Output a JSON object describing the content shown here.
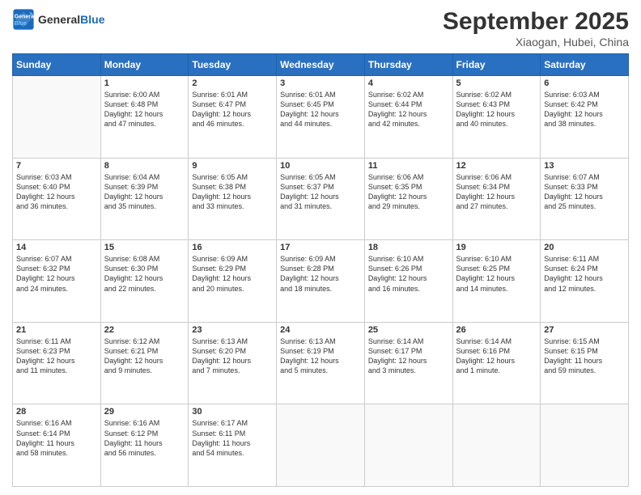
{
  "logo": {
    "line1": "General",
    "line2": "Blue"
  },
  "title": "September 2025",
  "subtitle": "Xiaogan, Hubei, China",
  "days_header": [
    "Sunday",
    "Monday",
    "Tuesday",
    "Wednesday",
    "Thursday",
    "Friday",
    "Saturday"
  ],
  "weeks": [
    [
      {
        "num": "",
        "info": ""
      },
      {
        "num": "1",
        "info": "Sunrise: 6:00 AM\nSunset: 6:48 PM\nDaylight: 12 hours\nand 47 minutes."
      },
      {
        "num": "2",
        "info": "Sunrise: 6:01 AM\nSunset: 6:47 PM\nDaylight: 12 hours\nand 46 minutes."
      },
      {
        "num": "3",
        "info": "Sunrise: 6:01 AM\nSunset: 6:45 PM\nDaylight: 12 hours\nand 44 minutes."
      },
      {
        "num": "4",
        "info": "Sunrise: 6:02 AM\nSunset: 6:44 PM\nDaylight: 12 hours\nand 42 minutes."
      },
      {
        "num": "5",
        "info": "Sunrise: 6:02 AM\nSunset: 6:43 PM\nDaylight: 12 hours\nand 40 minutes."
      },
      {
        "num": "6",
        "info": "Sunrise: 6:03 AM\nSunset: 6:42 PM\nDaylight: 12 hours\nand 38 minutes."
      }
    ],
    [
      {
        "num": "7",
        "info": "Sunrise: 6:03 AM\nSunset: 6:40 PM\nDaylight: 12 hours\nand 36 minutes."
      },
      {
        "num": "8",
        "info": "Sunrise: 6:04 AM\nSunset: 6:39 PM\nDaylight: 12 hours\nand 35 minutes."
      },
      {
        "num": "9",
        "info": "Sunrise: 6:05 AM\nSunset: 6:38 PM\nDaylight: 12 hours\nand 33 minutes."
      },
      {
        "num": "10",
        "info": "Sunrise: 6:05 AM\nSunset: 6:37 PM\nDaylight: 12 hours\nand 31 minutes."
      },
      {
        "num": "11",
        "info": "Sunrise: 6:06 AM\nSunset: 6:35 PM\nDaylight: 12 hours\nand 29 minutes."
      },
      {
        "num": "12",
        "info": "Sunrise: 6:06 AM\nSunset: 6:34 PM\nDaylight: 12 hours\nand 27 minutes."
      },
      {
        "num": "13",
        "info": "Sunrise: 6:07 AM\nSunset: 6:33 PM\nDaylight: 12 hours\nand 25 minutes."
      }
    ],
    [
      {
        "num": "14",
        "info": "Sunrise: 6:07 AM\nSunset: 6:32 PM\nDaylight: 12 hours\nand 24 minutes."
      },
      {
        "num": "15",
        "info": "Sunrise: 6:08 AM\nSunset: 6:30 PM\nDaylight: 12 hours\nand 22 minutes."
      },
      {
        "num": "16",
        "info": "Sunrise: 6:09 AM\nSunset: 6:29 PM\nDaylight: 12 hours\nand 20 minutes."
      },
      {
        "num": "17",
        "info": "Sunrise: 6:09 AM\nSunset: 6:28 PM\nDaylight: 12 hours\nand 18 minutes."
      },
      {
        "num": "18",
        "info": "Sunrise: 6:10 AM\nSunset: 6:26 PM\nDaylight: 12 hours\nand 16 minutes."
      },
      {
        "num": "19",
        "info": "Sunrise: 6:10 AM\nSunset: 6:25 PM\nDaylight: 12 hours\nand 14 minutes."
      },
      {
        "num": "20",
        "info": "Sunrise: 6:11 AM\nSunset: 6:24 PM\nDaylight: 12 hours\nand 12 minutes."
      }
    ],
    [
      {
        "num": "21",
        "info": "Sunrise: 6:11 AM\nSunset: 6:23 PM\nDaylight: 12 hours\nand 11 minutes."
      },
      {
        "num": "22",
        "info": "Sunrise: 6:12 AM\nSunset: 6:21 PM\nDaylight: 12 hours\nand 9 minutes."
      },
      {
        "num": "23",
        "info": "Sunrise: 6:13 AM\nSunset: 6:20 PM\nDaylight: 12 hours\nand 7 minutes."
      },
      {
        "num": "24",
        "info": "Sunrise: 6:13 AM\nSunset: 6:19 PM\nDaylight: 12 hours\nand 5 minutes."
      },
      {
        "num": "25",
        "info": "Sunrise: 6:14 AM\nSunset: 6:17 PM\nDaylight: 12 hours\nand 3 minutes."
      },
      {
        "num": "26",
        "info": "Sunrise: 6:14 AM\nSunset: 6:16 PM\nDaylight: 12 hours\nand 1 minute."
      },
      {
        "num": "27",
        "info": "Sunrise: 6:15 AM\nSunset: 6:15 PM\nDaylight: 11 hours\nand 59 minutes."
      }
    ],
    [
      {
        "num": "28",
        "info": "Sunrise: 6:16 AM\nSunset: 6:14 PM\nDaylight: 11 hours\nand 58 minutes."
      },
      {
        "num": "29",
        "info": "Sunrise: 6:16 AM\nSunset: 6:12 PM\nDaylight: 11 hours\nand 56 minutes."
      },
      {
        "num": "30",
        "info": "Sunrise: 6:17 AM\nSunset: 6:11 PM\nDaylight: 11 hours\nand 54 minutes."
      },
      {
        "num": "",
        "info": ""
      },
      {
        "num": "",
        "info": ""
      },
      {
        "num": "",
        "info": ""
      },
      {
        "num": "",
        "info": ""
      }
    ]
  ]
}
